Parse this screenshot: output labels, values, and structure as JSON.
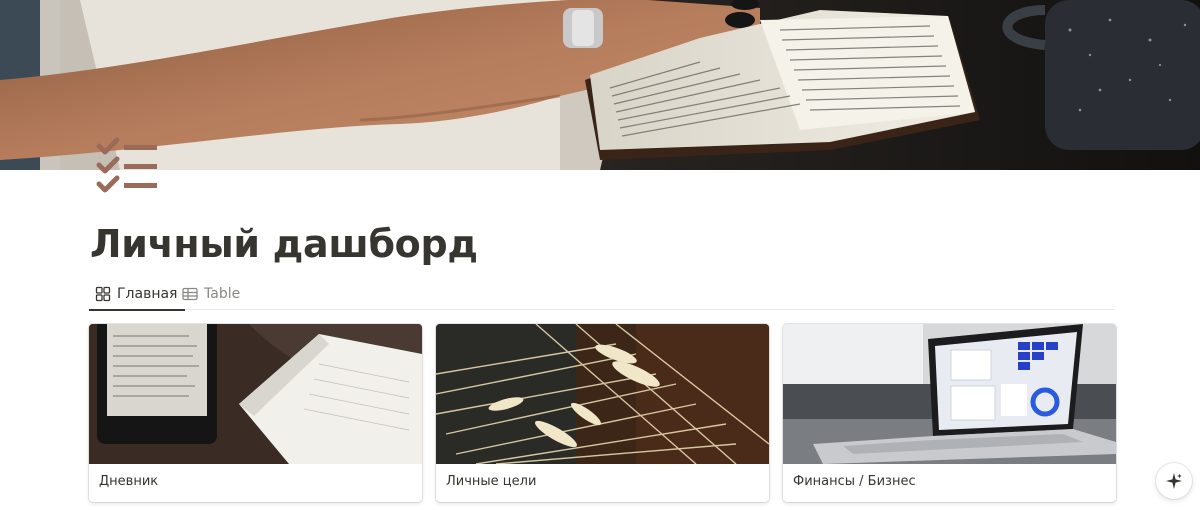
{
  "page": {
    "title": "Личный дашборд",
    "icon": "checklist-icon",
    "icon_color": "#9b6b5a",
    "cover_image": "hands-on-open-book"
  },
  "tabs": [
    {
      "label": "Главная",
      "icon": "gallery-icon",
      "active": true
    },
    {
      "label": "Table",
      "icon": "table-icon",
      "active": false
    }
  ],
  "gallery": {
    "cards": [
      {
        "title": "Дневник",
        "image": "ereader-and-notebook"
      },
      {
        "title": "Личные цели",
        "image": "wheat-ears"
      },
      {
        "title": "Финансы / Бизнес",
        "image": "laptop-with-dashboard"
      }
    ]
  },
  "floating": {
    "icon": "sparkle-icon"
  }
}
